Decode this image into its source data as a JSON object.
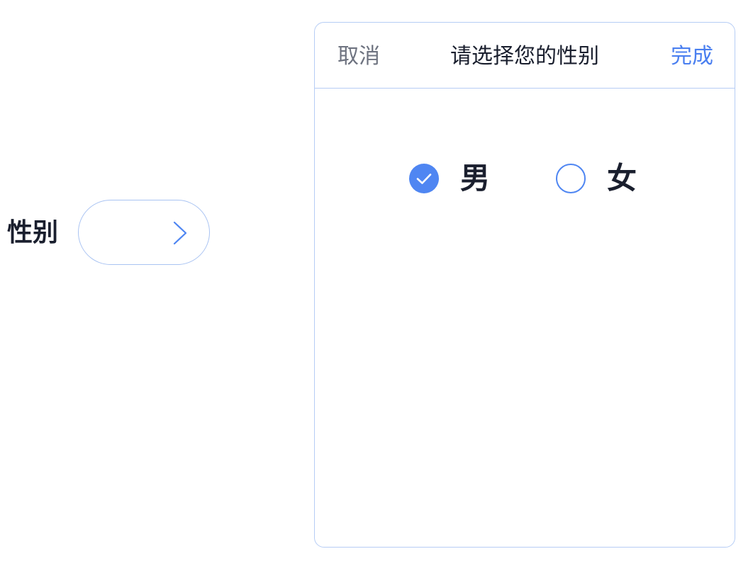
{
  "field": {
    "label": "性别",
    "value": "",
    "chevron_icon": "chevron-right-icon"
  },
  "picker": {
    "cancel_label": "取消",
    "title": "请选择您的性别",
    "done_label": "完成",
    "options": [
      {
        "label": "男",
        "selected": true
      },
      {
        "label": "女",
        "selected": false
      }
    ]
  },
  "colors": {
    "accent": "#4f86f2",
    "done_text": "#4a7ff0",
    "cancel_text": "#6e7380",
    "border": "#b6cdf5",
    "text": "#1a1f2e"
  }
}
